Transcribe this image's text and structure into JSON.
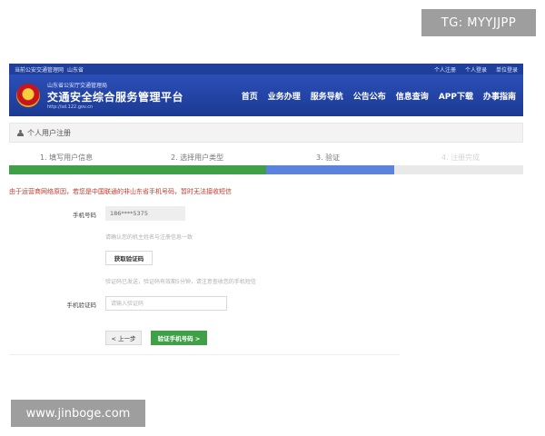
{
  "watermarks": {
    "top_right": "TG: MYYJJPP",
    "bottom_left": "www.jinboge.com"
  },
  "topbar": {
    "left_text": "当前公安交通管理网",
    "region": "山东省",
    "right_links": [
      "个人注册",
      "个人登录",
      "单位登录"
    ]
  },
  "header": {
    "subtitle": "山东省公安厅交通管理局",
    "title": "交通安全综合服务管理平台",
    "url": "http://sd.122.gov.cn",
    "nav": [
      "首页",
      "业务办理",
      "服务导航",
      "公告公布",
      "信息查询",
      "APP下载",
      "办事指南"
    ]
  },
  "page": {
    "heading": "个人用户注册"
  },
  "steps": {
    "items": [
      "1. 填写用户信息",
      "2. 选择用户类型",
      "3. 验证",
      "4. 注册完成"
    ],
    "progress": 0.75
  },
  "notice": "由于运营商网络原因，若您是中国联通的非山东省手机号码，暂时无法接收短信",
  "form": {
    "phone_label": "手机号码",
    "phone_value": "186****5375",
    "hint1": "请确认您的机主姓名与注册信息一致",
    "get_code_label": "获取验证码",
    "hint2": "验证码已发送，验证码有效期5分钟，请注意查收您的手机短信",
    "code_label": "手机验证码",
    "code_placeholder": "请输入验证码",
    "prev_label": "< 上一步",
    "verify_label": "验证手机号码 >"
  },
  "colors": {
    "brand_blue": "#1f3f9a",
    "progress_green": "#3fa047",
    "progress_blue": "#5b83de",
    "notice_red": "#c0392b"
  }
}
